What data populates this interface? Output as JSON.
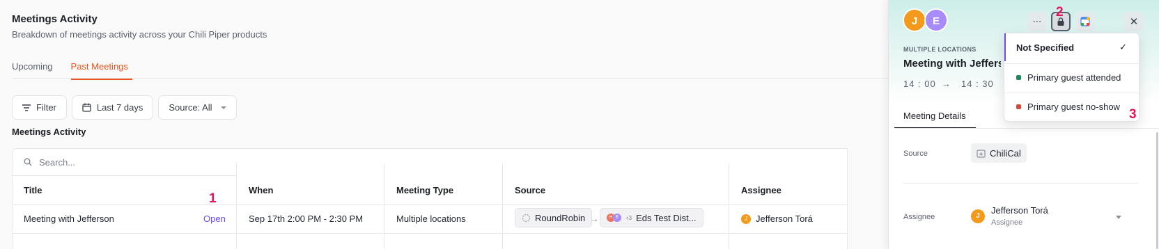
{
  "page": {
    "title": "Meetings Activity",
    "subtitle": "Breakdown of meetings activity across your Chili Piper products"
  },
  "tabs": [
    {
      "label": "Upcoming",
      "active": false
    },
    {
      "label": "Past Meetings",
      "active": true
    }
  ],
  "filters": {
    "filter_label": "Filter",
    "date_label": "Last 7 days",
    "source_label": "Source: All"
  },
  "section_title": "Meetings Activity",
  "search": {
    "placeholder": "Search..."
  },
  "table": {
    "headers": [
      "Title",
      "When",
      "Meeting Type",
      "Source",
      "Assignee"
    ],
    "rows": [
      {
        "title": "Meeting with Jefferson",
        "action": "Open",
        "when": "Sep 17th 2:00 PM - 2:30 PM",
        "meeting_type": "Multiple locations",
        "source_from": "RoundRobin",
        "source_avatars": [
          "H",
          "E"
        ],
        "source_more": "+3",
        "source_to": "Eds Test Dist...",
        "assignee_initial": "J",
        "assignee": "Jefferson Torá"
      }
    ]
  },
  "annotations": [
    "1",
    "2",
    "3"
  ],
  "drawer": {
    "avatars": [
      {
        "initial": "J",
        "color": "#f39a1d"
      },
      {
        "initial": "E",
        "color": "#a78bfa"
      }
    ],
    "kicker": "MULTIPLE LOCATIONS",
    "title": "Meeting with Jefferson",
    "time_start": "14 : 00",
    "time_end": "14 : 30",
    "tab": "Meeting Details",
    "source_label": "Source",
    "source_value": "ChiliCal",
    "assignee_label": "Assignee",
    "assignee_initial": "J",
    "assignee_name": "Jefferson Torá",
    "assignee_role": "Assignee"
  },
  "attendance_menu": {
    "items": [
      {
        "label": "Not Specified",
        "selected": true
      },
      {
        "label": "Primary guest attended",
        "status_color": "#1f8a5b"
      },
      {
        "label": "Primary guest no-show",
        "status_color": "#d9463b"
      }
    ]
  },
  "colors": {
    "accent": "#e8541c",
    "link": "#6c4bf5",
    "annotation": "#e3145a"
  }
}
